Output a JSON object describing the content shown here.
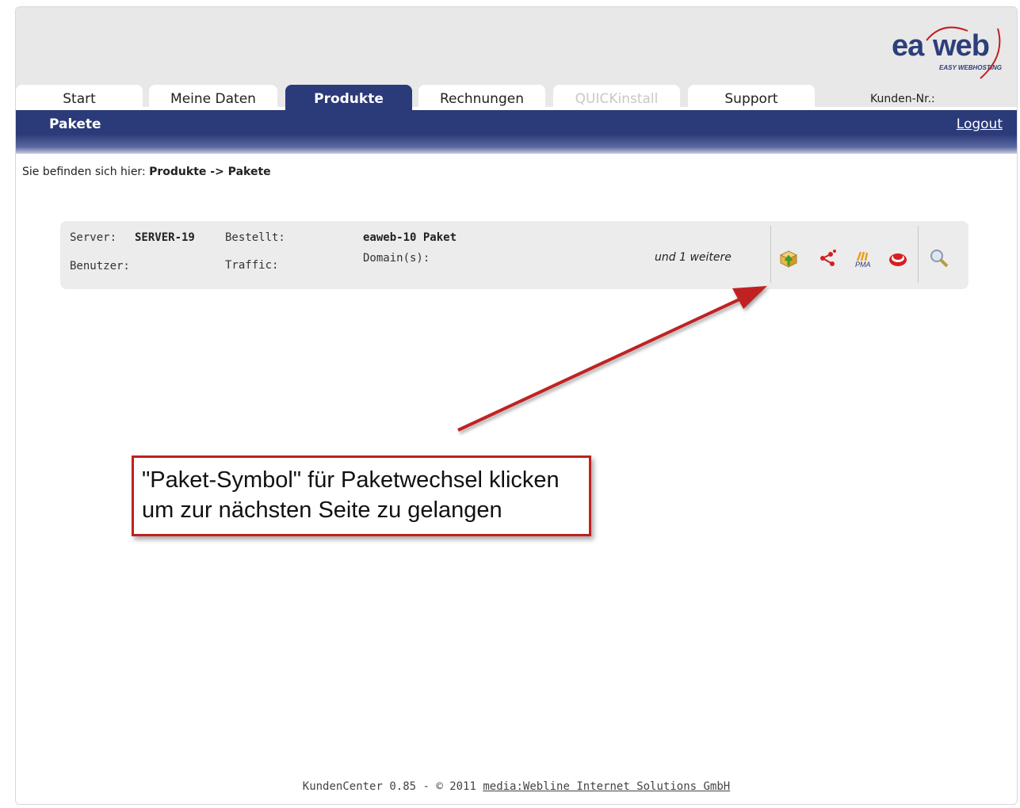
{
  "logo": {
    "ea": "ea",
    "web": "web",
    "tagline": "EASY WEBHOSTING"
  },
  "tabs": [
    {
      "label": "Start",
      "state": "normal"
    },
    {
      "label": "Meine Daten",
      "state": "normal"
    },
    {
      "label": "Produkte",
      "state": "active"
    },
    {
      "label": "Rechnungen",
      "state": "normal"
    },
    {
      "label": "QUICKinstall",
      "state": "disabled"
    },
    {
      "label": "Support",
      "state": "normal"
    }
  ],
  "customer_label": "Kunden-Nr.:",
  "navbar": {
    "title": "Pakete",
    "logout": "Logout"
  },
  "breadcrumb": {
    "prefix": "Sie befinden sich hier:",
    "path": "Produkte -> Pakete"
  },
  "package": {
    "server_label": "Server:",
    "server_value": "SERVER-19",
    "user_label": "Benutzer:",
    "ordered_label": "Bestellt:",
    "traffic_label": "Traffic:",
    "package_name": "eaweb-10 Paket",
    "domains_label": "Domain(s):",
    "more_domains": "und 1 weitere",
    "icons": [
      "package-change-icon",
      "share-icon",
      "phpmyadmin-icon",
      "lifebuoy-icon",
      "magnifier-icon"
    ],
    "pma_text": "PMA"
  },
  "callout": {
    "line1": "\"Paket-Symbol\" für Paketwechsel klicken",
    "line2": "um zur nächsten Seite zu gelangen"
  },
  "footer": {
    "text": "KundenCenter 0.85 - © 2011 ",
    "link": "media:Webline Internet Solutions GmbH"
  },
  "colors": {
    "nav": "#2b3a78",
    "arrow": "#c02020",
    "background": "#e8e8e8"
  }
}
